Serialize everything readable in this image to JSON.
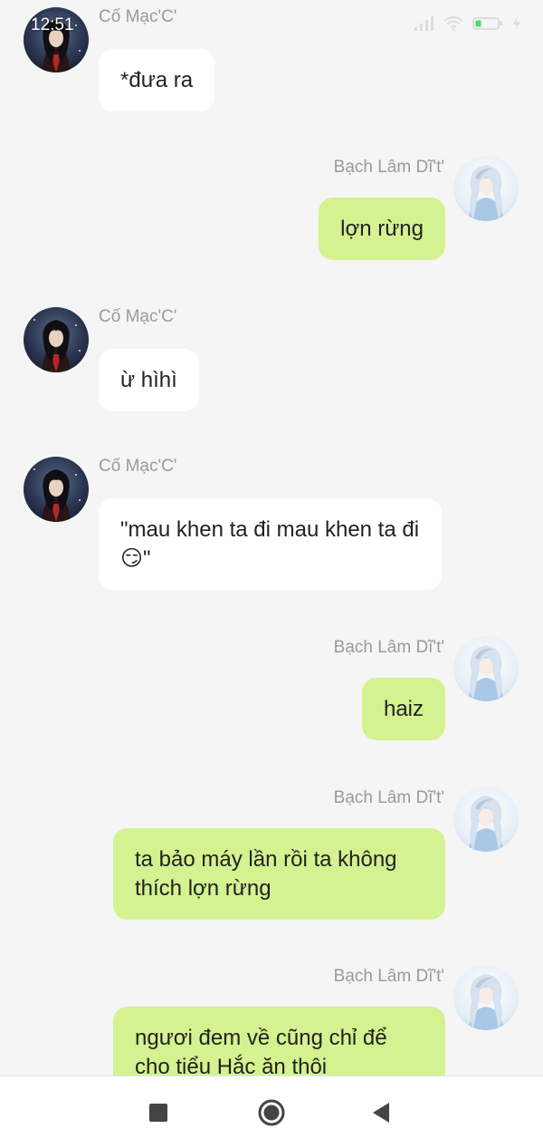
{
  "status_bar": {
    "time": "12:51",
    "icons": [
      "signal-icon",
      "wifi-icon",
      "battery-icon",
      "charging-icon"
    ]
  },
  "colors": {
    "background": "#f5f5f5",
    "incoming_bubble": "#ffffff",
    "outgoing_bubble": "#d4f290",
    "name_text": "#9a9a9a",
    "message_text": "#222222"
  },
  "messages": [
    {
      "side": "left",
      "sender": "Cố Mạc'C'",
      "text": "*đưa ra",
      "avatar": "dark-haired-character-avatar"
    },
    {
      "side": "right",
      "sender": "Bạch Lâm Dĩ't'",
      "text": "lợn rừng",
      "avatar": "white-haired-character-avatar"
    },
    {
      "side": "left",
      "sender": "Cố Mạc'C'",
      "text": "ừ hìhì",
      "avatar": "dark-haired-character-avatar"
    },
    {
      "side": "left",
      "sender": "Cố Mạc'C'",
      "text": "\"mau khen ta đi mau khen ta đi 😏\"",
      "avatar": "dark-haired-character-avatar"
    },
    {
      "side": "right",
      "sender": "Bạch Lâm Dĩ't'",
      "text": "haiz",
      "avatar": "white-haired-character-avatar"
    },
    {
      "side": "right",
      "sender": "Bạch Lâm Dĩ't'",
      "text": "ta bảo máy lần rồi ta không thích lợn rừng",
      "avatar": "white-haired-character-avatar"
    },
    {
      "side": "right",
      "sender": "Bạch Lâm Dĩ't'",
      "text": "ngươi đem về cũng chỉ để cho tiểu Hắc ăn thôi",
      "avatar": "white-haired-character-avatar"
    }
  ],
  "nav_bar": {
    "buttons": [
      "recents-square-icon",
      "home-circle-icon",
      "back-triangle-icon"
    ]
  }
}
